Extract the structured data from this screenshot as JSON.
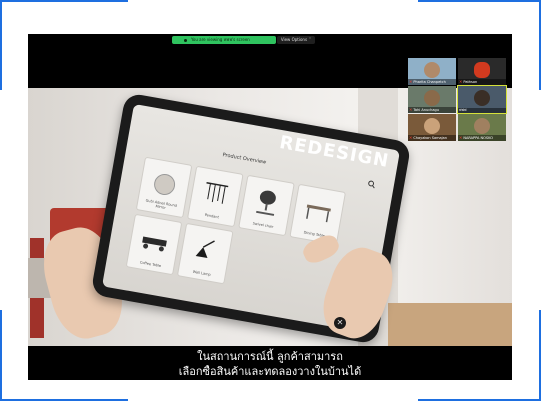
{
  "share_bar": {
    "status_text": "You are viewing ฟฟฟ's screen",
    "view_options_label": "View Options",
    "dropdown_glyph": "˅"
  },
  "app": {
    "brand_wordmark": "REDESIGN",
    "screen_title": "Product Overview",
    "products": [
      {
        "label": "Gubi Adnet Round Mirror",
        "icon": "mirror-icon"
      },
      {
        "label": "Pendant",
        "icon": "pendant-lamp-icon"
      },
      {
        "label": "Swivel chair",
        "icon": "office-chair-icon"
      },
      {
        "label": "Dining Table",
        "icon": "table-icon"
      },
      {
        "label": "Coffee Table",
        "icon": "low-table-icon"
      },
      {
        "label": "Wall Lamp",
        "icon": "wall-lamp-icon"
      }
    ]
  },
  "close_glyph": "✕",
  "subtitles": {
    "line1": "ในสถานการณ์นี้ ลูกค้าสามารถ",
    "line2": "เลือกซื้อสินค้าและทดลองวางในบ้านได้"
  },
  "participants": [
    {
      "name": "Pharita Chanpetch",
      "muted": true,
      "active": false
    },
    {
      "name": "Pathson",
      "muted": true,
      "active": false
    },
    {
      "name": "Tahi Anuchagu",
      "muted": true,
      "active": false
    },
    {
      "name": "ฟฟฟ",
      "muted": false,
      "active": true
    },
    {
      "name": "Chayakon Samajan",
      "muted": true,
      "active": false
    },
    {
      "name": "NARAPPA NOSKO",
      "muted": true,
      "active": false
    }
  ],
  "colors": {
    "share_green": "#2fc35f",
    "active_speaker_outline": "#d6e23a",
    "frame_blue": "#1e6fe0"
  }
}
